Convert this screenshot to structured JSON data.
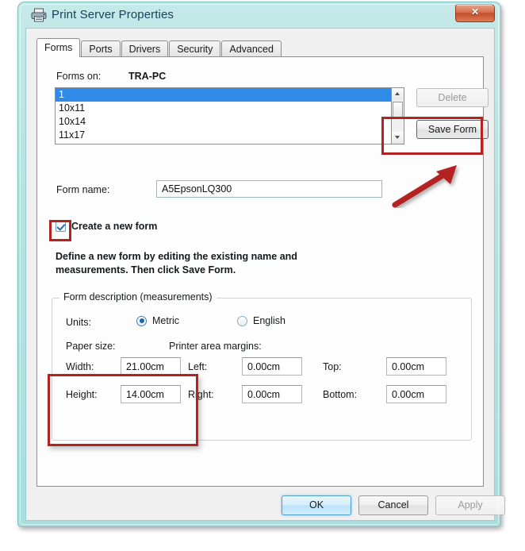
{
  "window": {
    "title": "Print Server Properties",
    "icon": "printer-icon",
    "close_label": "✕",
    "frame_color": "#b4e2e0",
    "accent_color": "#2f8ae8",
    "annotation_color": "#b42222"
  },
  "tabs": [
    {
      "label": "Forms",
      "active": true
    },
    {
      "label": "Ports",
      "active": false
    },
    {
      "label": "Drivers",
      "active": false
    },
    {
      "label": "Security",
      "active": false
    },
    {
      "label": "Advanced",
      "active": false
    }
  ],
  "forms_page": {
    "forms_on_label": "Forms on:",
    "forms_on_value": "TRA-PC",
    "list_items": [
      {
        "label": "1",
        "selected": true
      },
      {
        "label": "10x11",
        "selected": false
      },
      {
        "label": "10x14",
        "selected": false
      },
      {
        "label": "11x17",
        "selected": false
      }
    ],
    "delete_button": "Delete",
    "delete_enabled": false,
    "save_form_button": "Save Form",
    "save_form_enabled": true,
    "form_name_label": "Form name:",
    "form_name_value": "A5EpsonLQ300",
    "form_name_placeholder": "",
    "create_new_form_label": "Create a new form",
    "create_new_form_checked": true,
    "define_description": "Define a new form by editing the existing name and measurements. Then click Save Form."
  },
  "form_description": {
    "legend": "Form description (measurements)",
    "units_label": "Units:",
    "units_options": [
      {
        "label": "Metric",
        "selected": true
      },
      {
        "label": "English",
        "selected": false
      }
    ],
    "paper_size_label": "Paper size:",
    "margins_label": "Printer area margins:",
    "fields": {
      "width_label": "Width:",
      "width_value": "21.00cm",
      "height_label": "Height:",
      "height_value": "14.00cm",
      "left_label": "Left:",
      "left_value": "0.00cm",
      "right_label": "Right:",
      "right_value": "0.00cm",
      "top_label": "Top:",
      "top_value": "0.00cm",
      "bottom_label": "Bottom:",
      "bottom_value": "0.00cm"
    }
  },
  "footer": {
    "ok_label": "OK",
    "cancel_label": "Cancel",
    "apply_label": "Apply",
    "apply_enabled": false
  },
  "scrollbar": {
    "up_arrow": "scroll-up-arrow",
    "down_arrow": "scroll-down-arrow"
  }
}
